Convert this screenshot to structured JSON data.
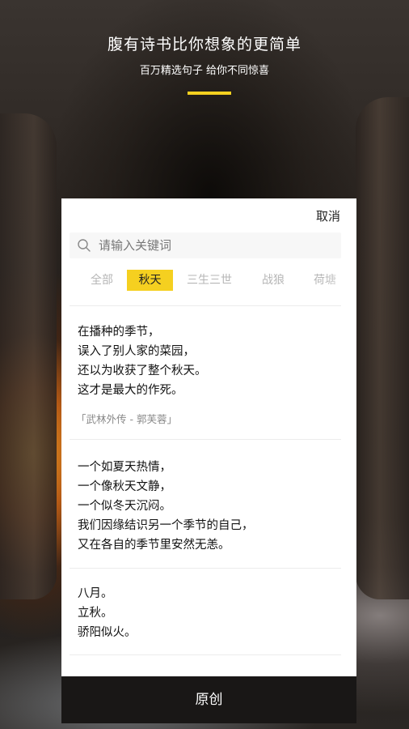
{
  "header": {
    "title": "腹有诗书比你想象的更简单",
    "subtitle": "百万精选句子 给你不同惊喜",
    "accent_color": "#f5d020"
  },
  "panel": {
    "cancel_label": "取消",
    "search": {
      "placeholder": "请输入关键词",
      "value": "",
      "icon": "search-icon"
    },
    "tabs": [
      "全部",
      "秋天",
      "三生三世",
      "战狼",
      "荷塘"
    ],
    "active_tab": "秋天",
    "quotes": [
      {
        "lines": [
          "在播种的季节，",
          "误入了别人家的菜园，",
          "还以为收获了整个秋天。",
          "这才是最大的作死。"
        ],
        "source": "「武林外传 - 郭芙蓉」"
      },
      {
        "lines": [
          "一个如夏天热情，",
          "一个像秋天文静，",
          "一个似冬天沉闷。",
          "我们因缘结识另一个季节的自己，",
          "又在各自的季节里安然无恙。"
        ]
      },
      {
        "lines": [
          "八月。",
          "立秋。",
          "骄阳似火。"
        ]
      }
    ]
  },
  "bottom_bar": {
    "label": "原创"
  }
}
